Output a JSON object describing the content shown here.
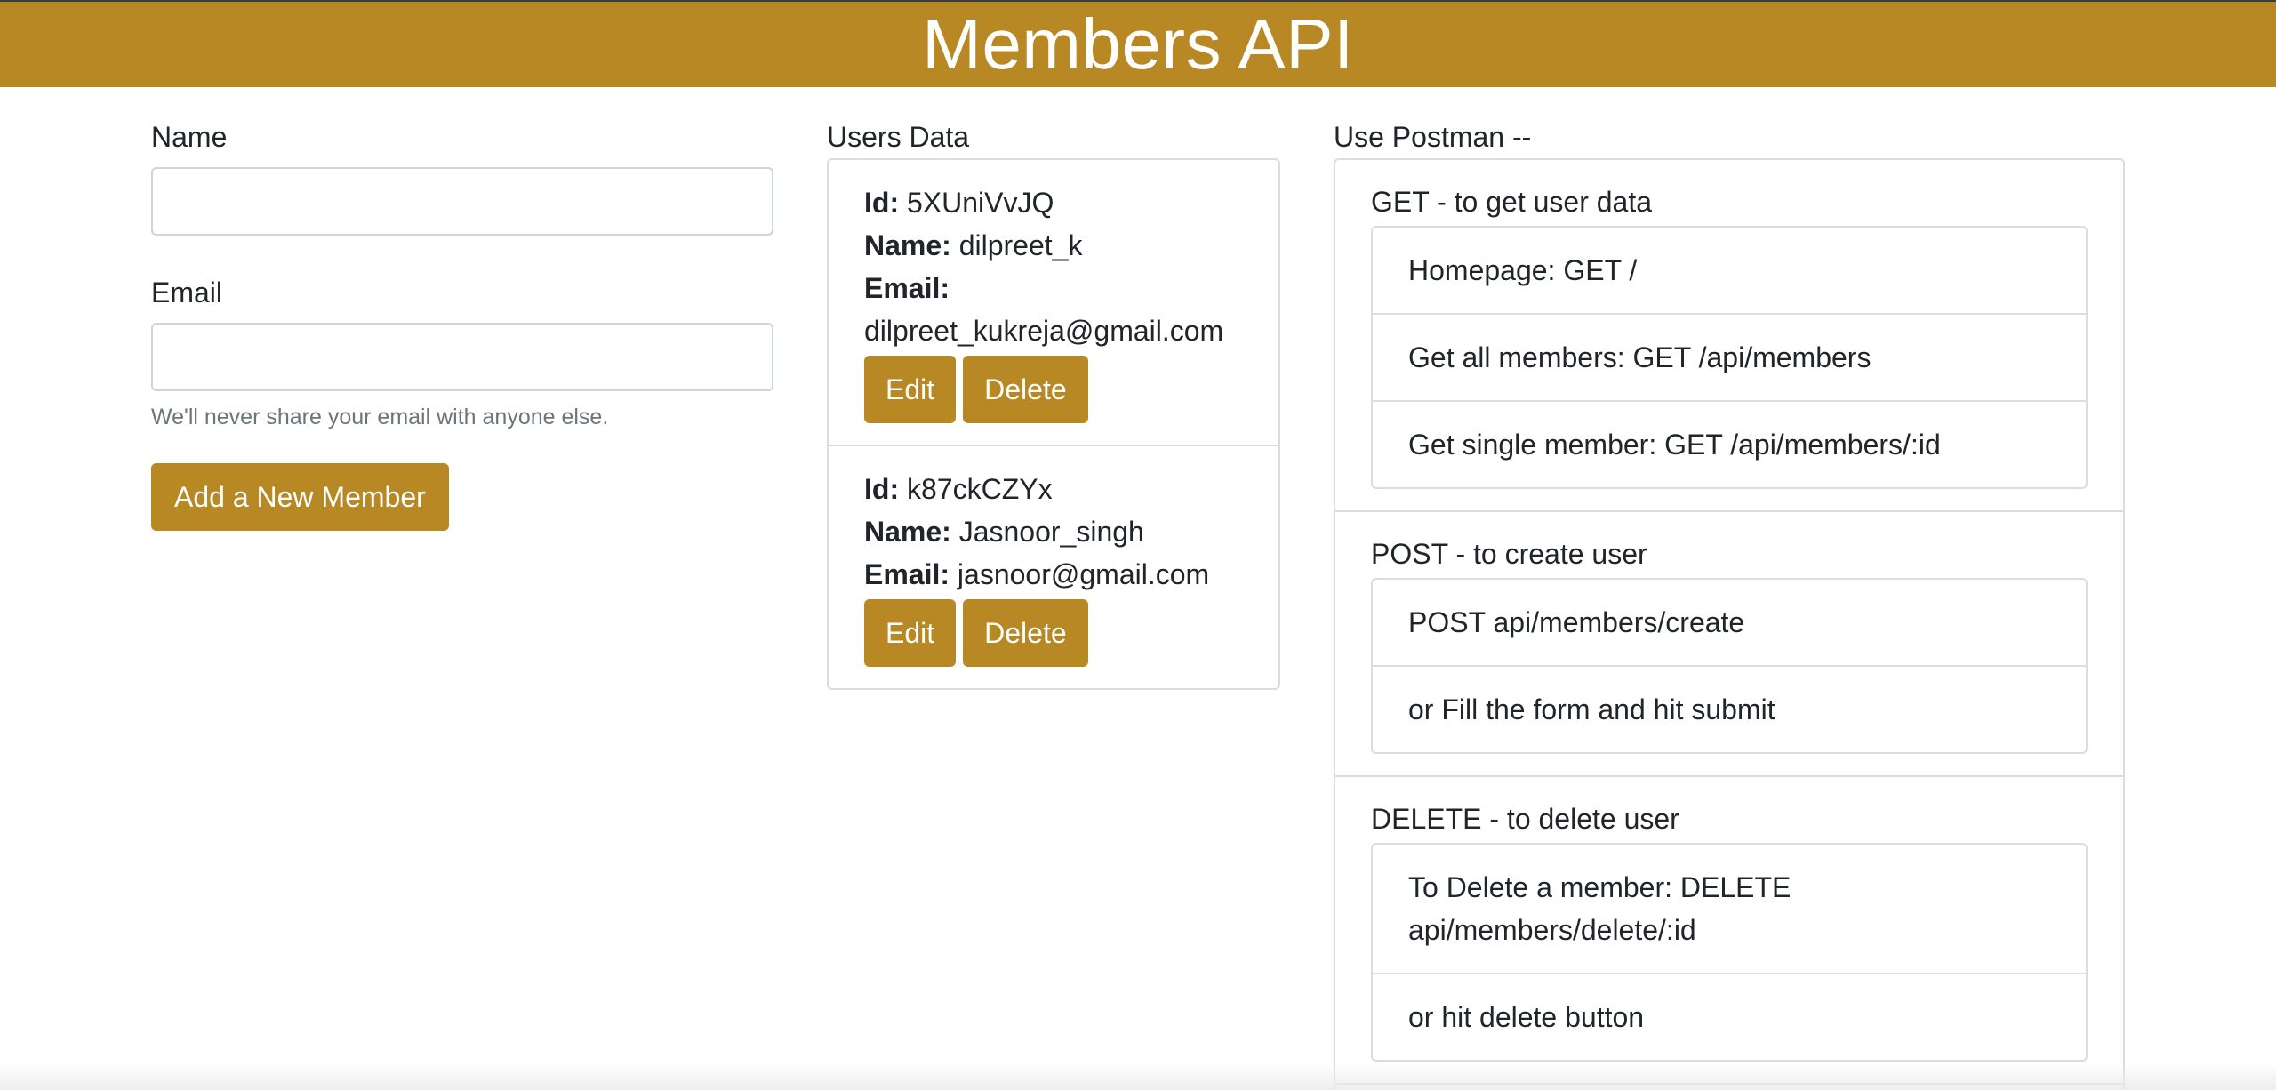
{
  "header": {
    "title": "Members API"
  },
  "form": {
    "name_label": "Name",
    "name_value": "",
    "email_label": "Email",
    "email_value": "",
    "email_help": "We'll never share your email with anyone else.",
    "submit_label": "Add a New Member"
  },
  "users": {
    "title": "Users Data",
    "id_label": "Id:",
    "name_label": "Name:",
    "email_label": "Email:",
    "edit_label": "Edit",
    "delete_label": "Delete",
    "items": [
      {
        "id": "5XUniVvJQ",
        "name": "dilpreet_k",
        "email": "dilpreet_kukreja@gmail.com"
      },
      {
        "id": "k87ckCZYx",
        "name": "Jasnoor_singh",
        "email": "jasnoor@gmail.com"
      }
    ]
  },
  "postman": {
    "title": "Use Postman --",
    "sections": [
      {
        "title": "GET - to get user data",
        "items": [
          "Homepage: GET /",
          "Get all members: GET /api/members",
          "Get single member: GET /api/members/:id"
        ]
      },
      {
        "title": "POST - to create user",
        "items": [
          "POST api/members/create",
          "or Fill the form and hit submit"
        ]
      },
      {
        "title": "DELETE - to delete user",
        "items": [
          "To Delete a member: DELETE api/members/delete/:id",
          "or hit delete button"
        ]
      }
    ]
  },
  "colors": {
    "accent": "#b78823",
    "border": "#dcdcdc",
    "help_text": "#6c757d"
  }
}
